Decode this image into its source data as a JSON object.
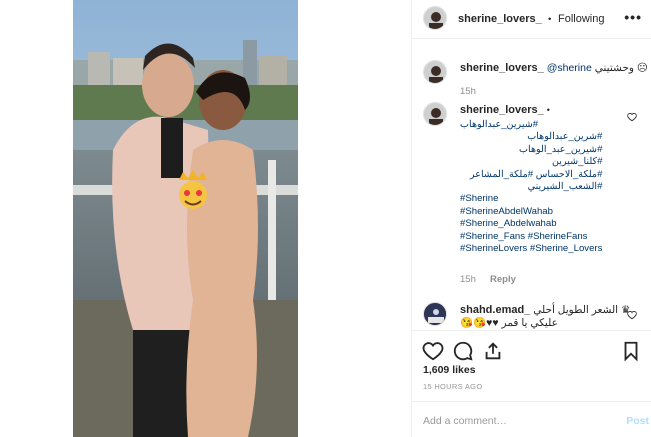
{
  "post": {
    "author": "sherine_lovers_",
    "follow_status": "Following",
    "separator": "•",
    "more_icon": "ellipsis-icon"
  },
  "comments": [
    {
      "username": "sherine_lovers_",
      "mention": "@sherine",
      "text": "وحشتيني",
      "emoji": "☹",
      "time": "15h"
    },
    {
      "username": "sherine_lovers_",
      "dot": "•",
      "hashtags": [
        "#شيرين_عبدالوهاب",
        "#شرين_عبدالوهاب",
        "#شيرين_عبد_الوهاب",
        "#كلنا_شيرين",
        "#ملكة_الاحساس #ملكة_المشاعر",
        "#الشعب_الشيريني",
        "#Sherine",
        "#SherineAbdelWahab",
        "#Sherine_Abdelwahab",
        "#Sherine_Fans #SherineFans",
        "#SherineLovers #Sherine_Lovers"
      ],
      "time": "15h",
      "reply": "Reply"
    },
    {
      "username": "shahd.emad_",
      "text_line1": "الشعر الطويل أحلي ♛",
      "text_line2": "عليكي يا قمر ♥♥😘😘"
    }
  ],
  "likes": "1,609 likes",
  "timestamp": "15 HOURS AGO",
  "add_comment": {
    "placeholder": "Add a comment…",
    "post_label": "Post"
  },
  "colors": {
    "hashtag": "#003569",
    "text": "#262626",
    "muted": "#8e8e8e",
    "post_disabled": "#b2dffc"
  }
}
